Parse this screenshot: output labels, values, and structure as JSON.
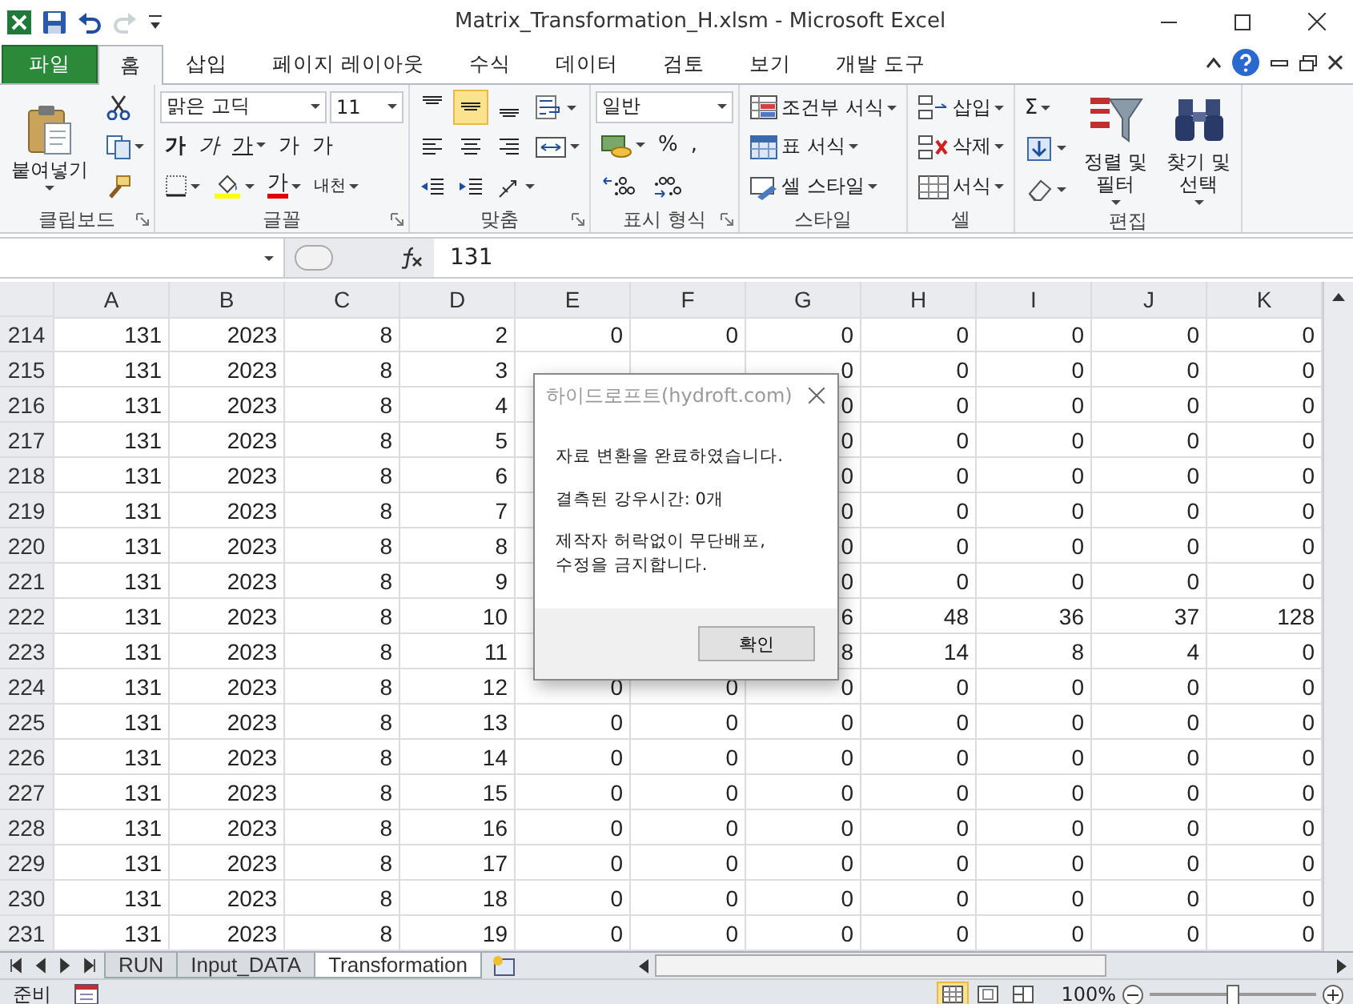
{
  "window": {
    "title": "Matrix_Transformation_H.xlsm  -  Microsoft Excel"
  },
  "quick_access": [
    {
      "kind": "save",
      "disabled": false
    },
    {
      "kind": "undo",
      "disabled": false
    },
    {
      "kind": "redo",
      "disabled": true
    },
    {
      "kind": "customize",
      "disabled": false
    }
  ],
  "ribbon_tabs": [
    {
      "label": "파일",
      "kind": "file",
      "selected": false
    },
    {
      "label": "홈",
      "kind": "tab",
      "selected": true
    },
    {
      "label": "삽입",
      "kind": "tab",
      "selected": false
    },
    {
      "label": "페이지 레이아웃",
      "kind": "tab",
      "selected": false
    },
    {
      "label": "수식",
      "kind": "tab",
      "selected": false
    },
    {
      "label": "데이터",
      "kind": "tab",
      "selected": false
    },
    {
      "label": "검토",
      "kind": "tab",
      "selected": false
    },
    {
      "label": "보기",
      "kind": "tab",
      "selected": false
    },
    {
      "label": "개발 도구",
      "kind": "tab",
      "selected": false
    }
  ],
  "ribbon_groups": [
    {
      "label": "클립보드",
      "launcher": true,
      "columns": [
        [
          [
            {
              "kind": "paste",
              "label": "붙여넣기"
            }
          ]
        ],
        [
          [
            {
              "kind": "cut"
            }
          ],
          [
            {
              "kind": "copy"
            }
          ],
          [
            {
              "kind": "painter"
            }
          ]
        ]
      ]
    },
    {
      "label": "글꼴",
      "launcher": true,
      "columns": [
        [
          [
            {
              "kind": "fontbox",
              "value": "맑은 고딕"
            },
            {
              "kind": "sizebox",
              "value": "11"
            }
          ],
          [
            {
              "kind": "bold",
              "label": "가"
            },
            {
              "kind": "italic",
              "label": "가"
            },
            {
              "kind": "underline",
              "label": "가"
            },
            {
              "kind": "grow",
              "label": "가"
            },
            {
              "kind": "shrink",
              "label": "가"
            }
          ],
          [
            {
              "kind": "border"
            },
            {
              "kind": "fill"
            },
            {
              "kind": "fontcolor",
              "label": "가"
            },
            {
              "kind": "phonetic",
              "label": "내천"
            }
          ]
        ]
      ]
    },
    {
      "label": "맞춤",
      "launcher": true,
      "columns": [
        [
          [
            {
              "kind": "aligntop",
              "selected": false
            },
            {
              "kind": "alignmiddle",
              "selected": true
            },
            {
              "kind": "alignbottom",
              "selected": false
            },
            {
              "kind": "wrap"
            }
          ],
          [
            {
              "kind": "alignleft",
              "selected": false
            },
            {
              "kind": "aligncenter",
              "selected": false
            },
            {
              "kind": "alignright",
              "selected": false
            },
            {
              "kind": "merge"
            }
          ],
          [
            {
              "kind": "outdent"
            },
            {
              "kind": "indent"
            },
            {
              "kind": "orientation"
            }
          ]
        ]
      ]
    },
    {
      "label": "표시 형식",
      "launcher": true,
      "columns": [
        [
          [
            {
              "kind": "formatbox",
              "value": "일반"
            }
          ],
          [
            {
              "kind": "currency"
            },
            {
              "kind": "percent",
              "label": "%"
            },
            {
              "kind": "comma",
              "label": ","
            }
          ],
          [
            {
              "kind": "increase"
            },
            {
              "kind": "decrease"
            }
          ]
        ]
      ]
    },
    {
      "label": "스타일",
      "launcher": false,
      "columns": [
        [
          [
            {
              "kind": "condformat",
              "label": "조건부 서식"
            }
          ],
          [
            {
              "kind": "tableformat",
              "label": "표 서식"
            }
          ],
          [
            {
              "kind": "cellstyle",
              "label": "셀 스타일"
            }
          ]
        ]
      ]
    },
    {
      "label": "셀",
      "launcher": false,
      "columns": [
        [
          [
            {
              "kind": "insert",
              "label": "삽입"
            }
          ],
          [
            {
              "kind": "delete",
              "label": "삭제"
            }
          ],
          [
            {
              "kind": "format",
              "label": "서식"
            }
          ]
        ]
      ]
    },
    {
      "label": "편집",
      "launcher": false,
      "columns": [
        [
          [
            {
              "kind": "sum",
              "label": "Σ"
            }
          ],
          [
            {
              "kind": "filldown"
            }
          ],
          [
            {
              "kind": "clear"
            }
          ]
        ],
        [
          [
            {
              "kind": "sort",
              "label": "정렬 및\n필터"
            }
          ]
        ],
        [
          [
            {
              "kind": "find",
              "label": "찾기 및\n선택"
            }
          ]
        ]
      ]
    }
  ],
  "formula_bar": {
    "value": "131"
  },
  "columns": [
    "A",
    "B",
    "C",
    "D",
    "E",
    "F",
    "G",
    "H",
    "I",
    "J",
    "K"
  ],
  "rows": [
    {
      "header": "214",
      "cells": [
        "131",
        "2023",
        "8",
        "2",
        "0",
        "0",
        "0",
        "0",
        "0",
        "0",
        "0"
      ]
    },
    {
      "header": "215",
      "cells": [
        "131",
        "2023",
        "8",
        "3",
        null,
        null,
        "0",
        "0",
        "0",
        "0",
        "0"
      ]
    },
    {
      "header": "216",
      "cells": [
        "131",
        "2023",
        "8",
        "4",
        null,
        null,
        "0",
        "0",
        "0",
        "0",
        "0"
      ]
    },
    {
      "header": "217",
      "cells": [
        "131",
        "2023",
        "8",
        "5",
        null,
        null,
        "0",
        "0",
        "0",
        "0",
        "0"
      ]
    },
    {
      "header": "218",
      "cells": [
        "131",
        "2023",
        "8",
        "6",
        null,
        null,
        "0",
        "0",
        "0",
        "0",
        "0"
      ]
    },
    {
      "header": "219",
      "cells": [
        "131",
        "2023",
        "8",
        "7",
        null,
        null,
        "0",
        "0",
        "0",
        "0",
        "0"
      ]
    },
    {
      "header": "220",
      "cells": [
        "131",
        "2023",
        "8",
        "8",
        null,
        null,
        "0",
        "0",
        "0",
        "0",
        "0"
      ]
    },
    {
      "header": "221",
      "cells": [
        "131",
        "2023",
        "8",
        "9",
        null,
        null,
        "0",
        "0",
        "0",
        "0",
        "0"
      ]
    },
    {
      "header": "222",
      "cells": [
        "131",
        "2023",
        "8",
        "10",
        null,
        null,
        "6",
        "48",
        "36",
        "37",
        "128"
      ]
    },
    {
      "header": "223",
      "cells": [
        "131",
        "2023",
        "8",
        "11",
        null,
        null,
        "8",
        "14",
        "8",
        "4",
        "0"
      ]
    },
    {
      "header": "224",
      "cells": [
        "131",
        "2023",
        "8",
        "12",
        "0",
        "0",
        "0",
        "0",
        "0",
        "0",
        "0"
      ]
    },
    {
      "header": "225",
      "cells": [
        "131",
        "2023",
        "8",
        "13",
        "0",
        "0",
        "0",
        "0",
        "0",
        "0",
        "0"
      ]
    },
    {
      "header": "226",
      "cells": [
        "131",
        "2023",
        "8",
        "14",
        "0",
        "0",
        "0",
        "0",
        "0",
        "0",
        "0"
      ]
    },
    {
      "header": "227",
      "cells": [
        "131",
        "2023",
        "8",
        "15",
        "0",
        "0",
        "0",
        "0",
        "0",
        "0",
        "0"
      ]
    },
    {
      "header": "228",
      "cells": [
        "131",
        "2023",
        "8",
        "16",
        "0",
        "0",
        "0",
        "0",
        "0",
        "0",
        "0"
      ]
    },
    {
      "header": "229",
      "cells": [
        "131",
        "2023",
        "8",
        "17",
        "0",
        "0",
        "0",
        "0",
        "0",
        "0",
        "0"
      ]
    },
    {
      "header": "230",
      "cells": [
        "131",
        "2023",
        "8",
        "18",
        "0",
        "0",
        "0",
        "0",
        "0",
        "0",
        "0"
      ]
    },
    {
      "header": "231",
      "cells": [
        "131",
        "2023",
        "8",
        "19",
        "0",
        "0",
        "0",
        "0",
        "0",
        "0",
        "0"
      ]
    }
  ],
  "sheet_tabs": [
    {
      "label": "RUN",
      "selected": false
    },
    {
      "label": "Input_DATA",
      "selected": false
    },
    {
      "label": "Transformation",
      "selected": true
    }
  ],
  "status_bar": {
    "mode": "준비",
    "views": [
      {
        "kind": "normal",
        "selected": true
      },
      {
        "kind": "layout",
        "selected": false
      },
      {
        "kind": "pagebreak",
        "selected": false
      }
    ],
    "zoom": "100%",
    "zoom_slider": {
      "level": 0.5
    }
  },
  "dialog": {
    "title": "하이드로프트(hydroft.com)",
    "messages": [
      "자료 변환을 완료하였습니다.",
      "결측된 강우시간: 0개",
      "제작자 허락없이 무단배포,\n수정을 금지합니다."
    ],
    "button": "확인"
  }
}
